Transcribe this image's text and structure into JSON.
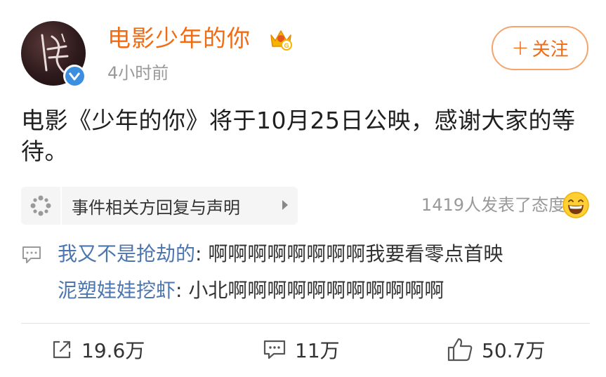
{
  "post": {
    "username": "电影少年的你",
    "timestamp": "4小时前",
    "follow_label": "关注",
    "follow_plus": "+",
    "content": "电影《少年的你》将于10月25日公映，感谢大家的等待。",
    "event_chip": {
      "label": "事件相关方回复与声明",
      "icon": "sparkle-icon"
    },
    "attitudes_text": "1419人发表了态度"
  },
  "comments": [
    {
      "author": "我又不是抢劫的",
      "separator": ": ",
      "text": "啊啊啊啊啊啊啊啊我要看零点首映"
    },
    {
      "author": "泥塑娃娃挖虾",
      "separator": ": ",
      "text": "小北啊啊啊啊啊啊啊啊啊啊啊"
    }
  ],
  "actions": {
    "repost": {
      "icon": "share-icon",
      "count": "19.6万"
    },
    "comment": {
      "icon": "comment-icon",
      "count": "11万"
    },
    "like": {
      "icon": "thumbs-up-icon",
      "count": "50.7万"
    }
  },
  "colors": {
    "brand_orange": "#f26a11",
    "link_blue": "#4c76b0",
    "muted_gray": "#999999",
    "verified_blue": "#3b8fde"
  }
}
